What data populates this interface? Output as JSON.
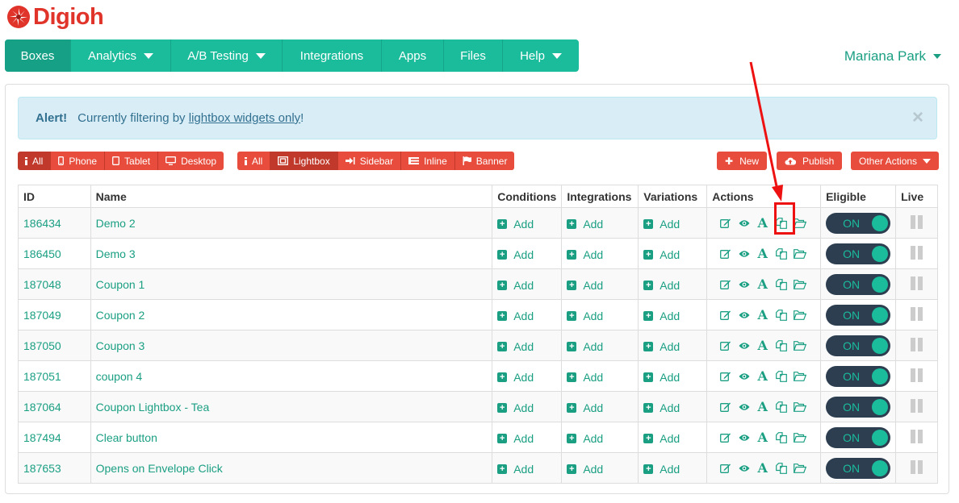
{
  "brand": {
    "name": "Digioh"
  },
  "nav": {
    "items": [
      {
        "label": "Boxes",
        "dropdown": false,
        "active": true
      },
      {
        "label": "Analytics",
        "dropdown": true
      },
      {
        "label": "A/B Testing",
        "dropdown": true
      },
      {
        "label": "Integrations",
        "dropdown": false
      },
      {
        "label": "Apps",
        "dropdown": false
      },
      {
        "label": "Files",
        "dropdown": false
      },
      {
        "label": "Help",
        "dropdown": true
      }
    ]
  },
  "user": {
    "name": "Mariana Park"
  },
  "alert": {
    "title": "Alert!",
    "text_before": "Currently filtering by ",
    "link": "lightbox widgets only",
    "text_after": "!",
    "close": "×"
  },
  "device_filters": [
    {
      "label": "All",
      "icon": "info-icon",
      "active": true
    },
    {
      "label": "Phone",
      "icon": "phone-icon"
    },
    {
      "label": "Tablet",
      "icon": "tablet-icon"
    },
    {
      "label": "Desktop",
      "icon": "desktop-icon"
    }
  ],
  "type_filters": [
    {
      "label": "All",
      "icon": "info-icon"
    },
    {
      "label": "Lightbox",
      "icon": "lightbox-icon",
      "active": true
    },
    {
      "label": "Sidebar",
      "icon": "sidebar-icon"
    },
    {
      "label": "Inline",
      "icon": "inline-icon"
    },
    {
      "label": "Banner",
      "icon": "flag-icon"
    }
  ],
  "toolbar": {
    "new_label": "New",
    "publish_label": "Publish",
    "other_label": "Other Actions"
  },
  "table": {
    "headers": {
      "id": "ID",
      "name": "Name",
      "conditions": "Conditions",
      "integrations": "Integrations",
      "variations": "Variations",
      "actions": "Actions",
      "eligible": "Eligible",
      "live": "Live"
    },
    "add_label": "Add",
    "toggle_label": "ON",
    "rows": [
      {
        "id": "186434",
        "name": "Demo 2"
      },
      {
        "id": "186450",
        "name": "Demo 3"
      },
      {
        "id": "187048",
        "name": "Coupon 1"
      },
      {
        "id": "187049",
        "name": "Coupon 2"
      },
      {
        "id": "187050",
        "name": "Coupon 3"
      },
      {
        "id": "187051",
        "name": "coupon 4"
      },
      {
        "id": "187064",
        "name": "Coupon Lightbox - Tea"
      },
      {
        "id": "187494",
        "name": "Clear button"
      },
      {
        "id": "187653",
        "name": "Opens on Envelope Click"
      }
    ]
  },
  "annotation": {
    "target": "copy action, first row"
  },
  "colors": {
    "accent": "#1abc9c",
    "danger": "#e74c3c",
    "annotation": "#ee1111"
  }
}
